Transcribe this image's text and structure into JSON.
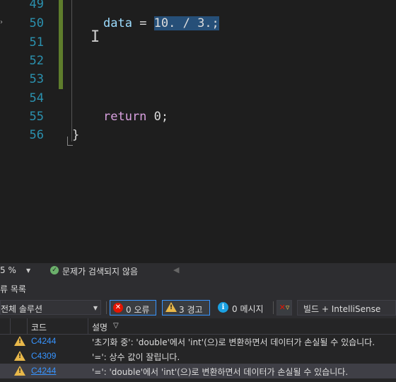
{
  "editor": {
    "lines": [
      {
        "num": "49"
      },
      {
        "num": "50"
      },
      {
        "num": "51"
      },
      {
        "num": "52"
      },
      {
        "num": "53"
      },
      {
        "num": "54"
      },
      {
        "num": "55"
      },
      {
        "num": "56"
      }
    ],
    "line50": {
      "var": "data",
      "op": " = ",
      "expr": "10. / 3.;"
    },
    "line55": {
      "kw": "return",
      "rest": " 0;"
    },
    "line56": {
      "brace": "}"
    }
  },
  "status": {
    "zoom": "5 %",
    "issues": "문제가 검색되지 않음"
  },
  "errors_panel": {
    "title": "류 목록",
    "scope": "전체 솔루션",
    "errors_btn": "0 오류",
    "warnings_btn": "3 경고",
    "messages_btn": "0 메시지",
    "build_filter": "빌드 + IntelliSense",
    "columns": {
      "code": "코드",
      "desc": "설명"
    },
    "rows": [
      {
        "code": "C4244",
        "desc": "'초기화 중': 'double'에서 'int'(으)로 변환하면서 데이터가 손실될 수 있습니다."
      },
      {
        "code": "C4309",
        "desc": "'=': 상수 값이 잘립니다."
      },
      {
        "code": "C4244",
        "desc": "'=': 'double'에서 'int'(으)로 변환하면서 데이터가 손실될 수 있습니다."
      }
    ]
  },
  "colors": {
    "accent": "#3794ff",
    "warning": "#e8b84a",
    "error": "#e51400",
    "change_bar": "#5e7d2c",
    "selection": "#264f78"
  }
}
